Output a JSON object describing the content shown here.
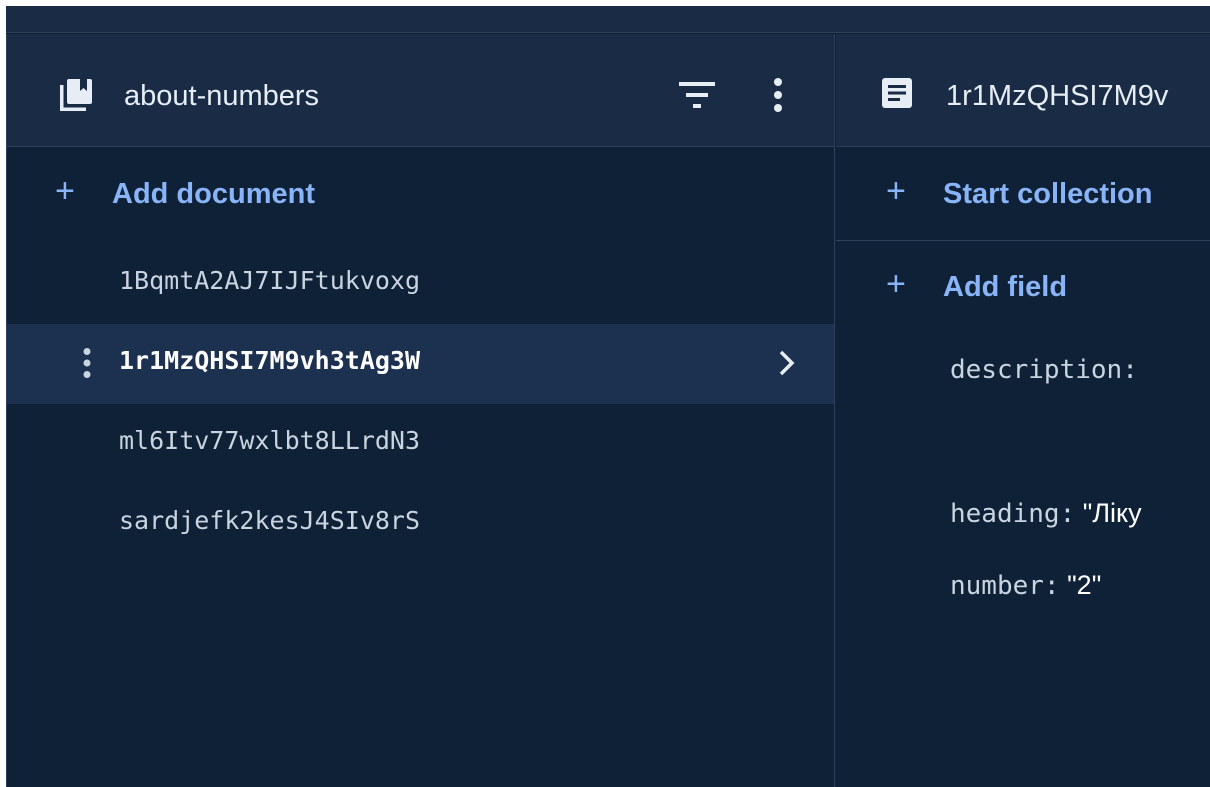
{
  "collection_panel": {
    "title": "about-numbers",
    "add_document_label": "Add document",
    "plus_glyph": "+",
    "documents": [
      {
        "id": "1BqmtA2AJ7IJFtukvoxg",
        "selected": false
      },
      {
        "id": "1r1MzQHSI7M9vh3tAg3W",
        "selected": true
      },
      {
        "id": "ml6Itv77wxlbt8LLrdN3",
        "selected": false
      },
      {
        "id": "sardjefk2kesJ4SIv8rS",
        "selected": false
      }
    ],
    "icons": {
      "collection": "collection-icon",
      "filter": "filter-icon",
      "more": "more-vert-icon",
      "row_more": "more-vert-icon",
      "row_chevron": "chevron-right-icon"
    }
  },
  "document_panel": {
    "title": "1r1MzQHSI7M9v",
    "start_collection_label": "Start collection",
    "add_field_label": "Add field",
    "plus_glyph": "+",
    "fields": [
      {
        "key": "description",
        "colon": ":",
        "value": ""
      },
      {
        "key": "heading",
        "colon": ":",
        "value": "\"Ліку"
      },
      {
        "key": "number",
        "colon": ":",
        "value": "\"2\""
      }
    ],
    "icons": {
      "document": "document-icon"
    }
  },
  "colors": {
    "background": "#0f2137",
    "header": "#1a2c45",
    "accent": "#8ab4f8",
    "selected_row": "#1c3150",
    "divider": "#2c4059"
  }
}
